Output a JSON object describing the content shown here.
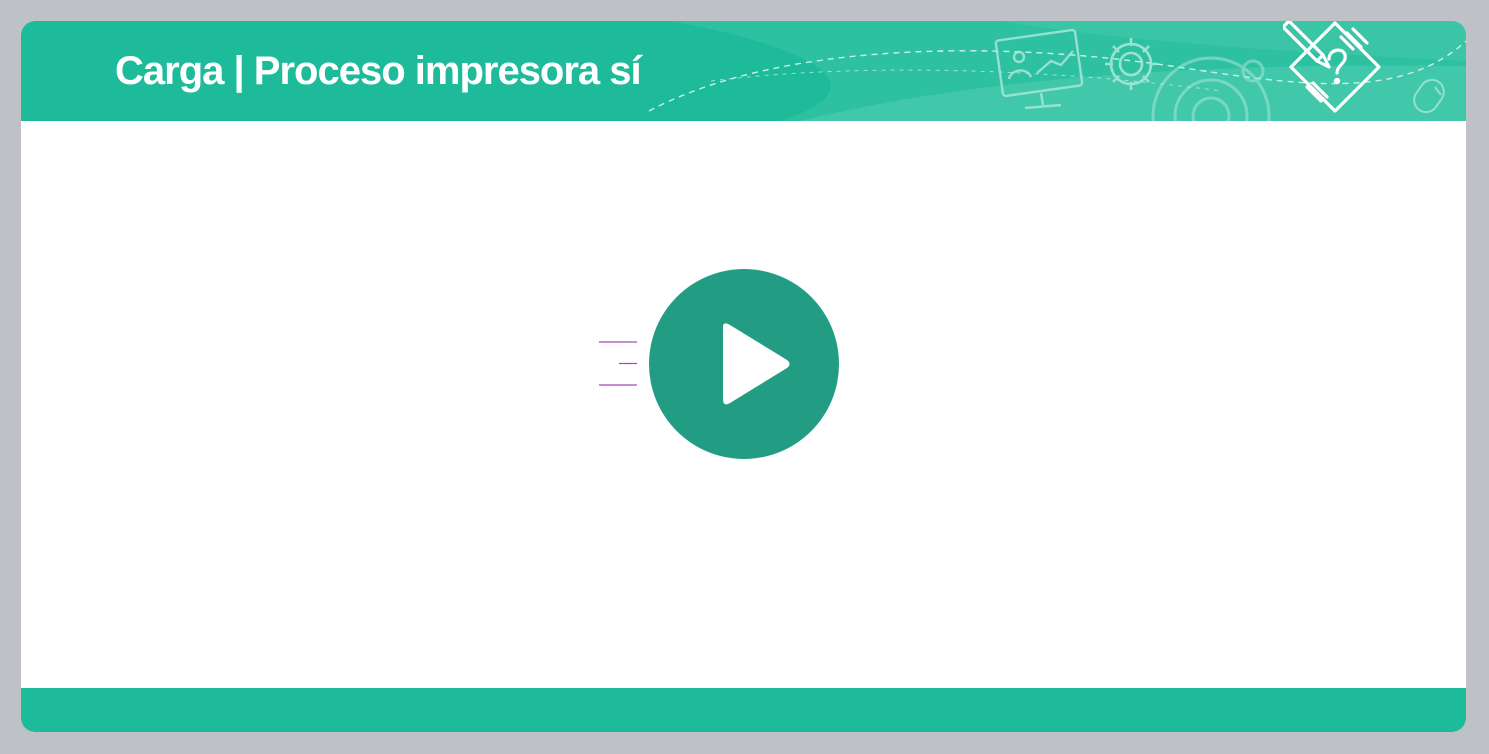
{
  "header": {
    "title": "Carga | Proceso impresora sí",
    "decorative_icons": [
      "presentation-screen-icon",
      "gear-icon",
      "gears-icon",
      "mouse-icon"
    ],
    "hero_icon": "writing-hand-question-icon"
  },
  "player": {
    "play_icon": "play-icon"
  },
  "colors": {
    "page_background": "#bec2c6",
    "header": "#1dbb9a",
    "footer": "#1dbb9a",
    "play_button": "#239c84",
    "speed_lines": "#a24bb5",
    "content": "#ffffff"
  }
}
